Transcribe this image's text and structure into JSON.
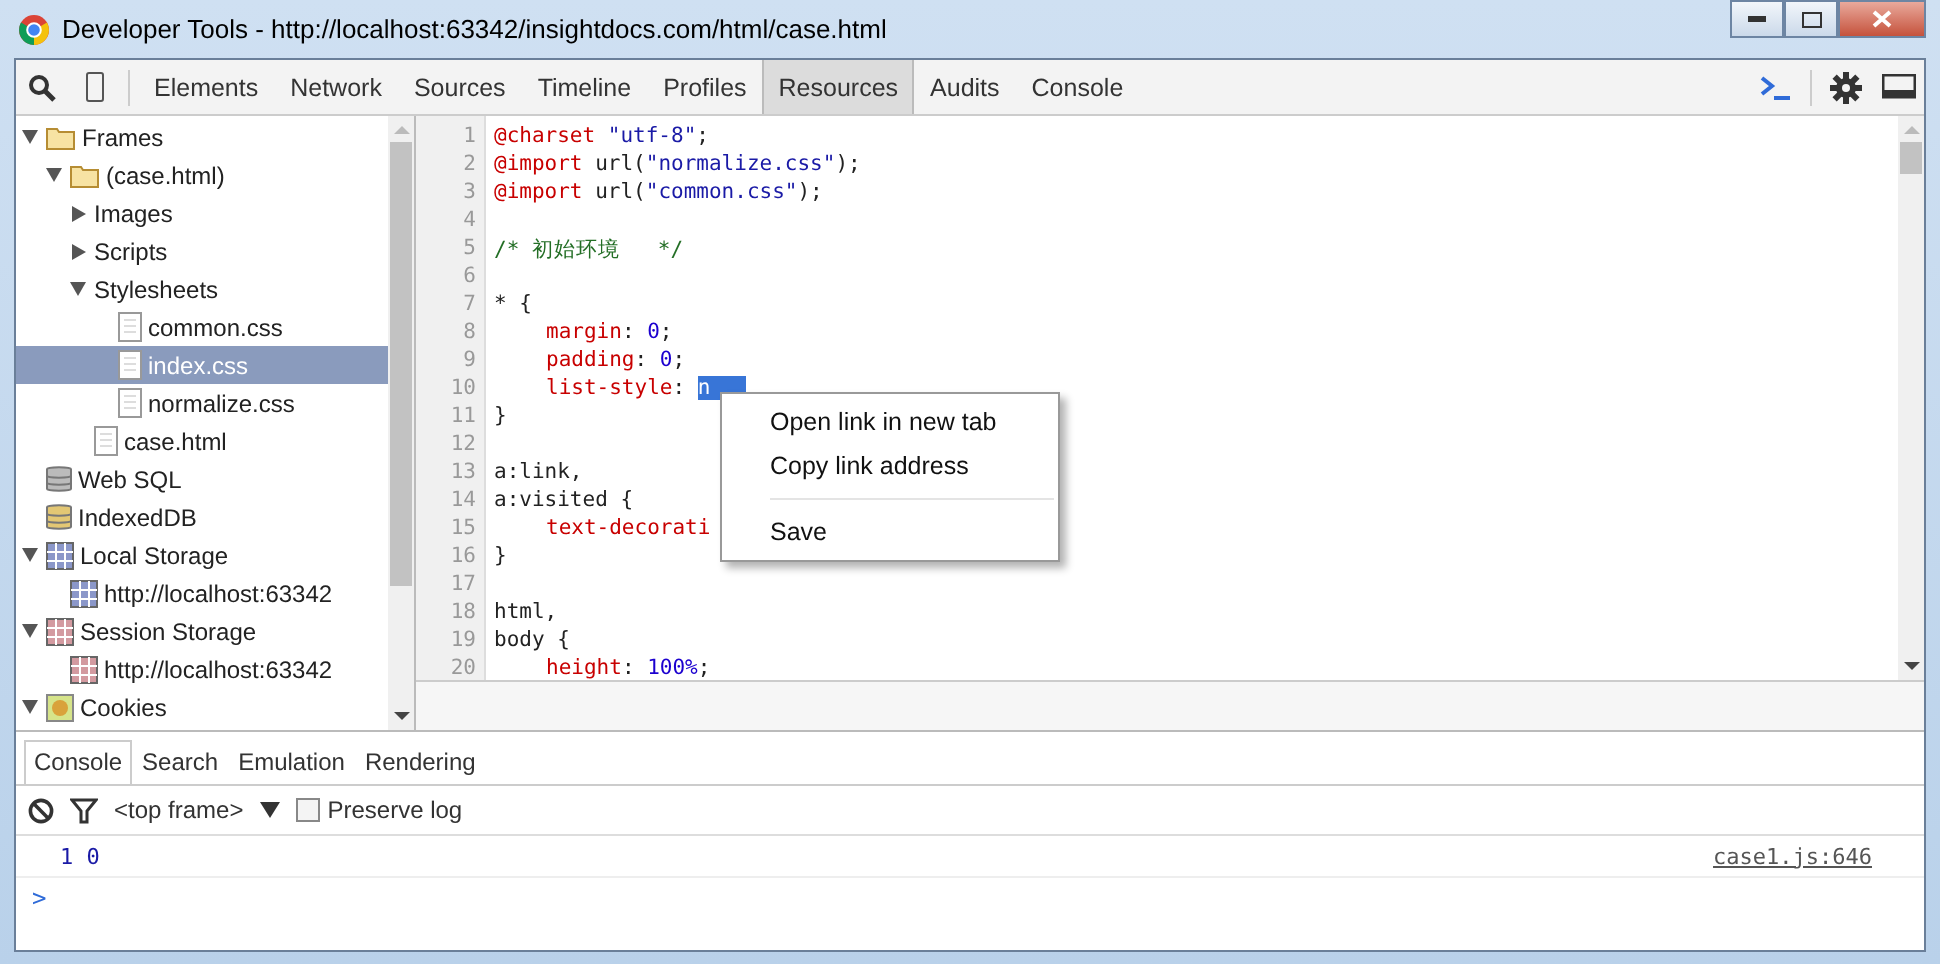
{
  "window": {
    "title": "Developer Tools - http://localhost:63342/insightdocs.com/html/case.html"
  },
  "toolbar": {
    "tabs": [
      {
        "label": "Elements",
        "selected": false
      },
      {
        "label": "Network",
        "selected": false
      },
      {
        "label": "Sources",
        "selected": false
      },
      {
        "label": "Timeline",
        "selected": false
      },
      {
        "label": "Profiles",
        "selected": false
      },
      {
        "label": "Resources",
        "selected": true
      },
      {
        "label": "Audits",
        "selected": false
      },
      {
        "label": "Console",
        "selected": false
      }
    ]
  },
  "sidebar": {
    "items": [
      {
        "label": "Frames",
        "kind": "folder",
        "expanded": true,
        "selected": false,
        "children": [
          {
            "label": "(case.html)",
            "kind": "folder",
            "expanded": true,
            "selected": false,
            "children": [
              {
                "label": "Images",
                "kind": "group",
                "expanded": false,
                "selected": false
              },
              {
                "label": "Scripts",
                "kind": "group",
                "expanded": false,
                "selected": false
              },
              {
                "label": "Stylesheets",
                "kind": "group",
                "expanded": true,
                "selected": false,
                "children": [
                  {
                    "label": "common.css",
                    "kind": "file",
                    "selected": false
                  },
                  {
                    "label": "index.css",
                    "kind": "file",
                    "selected": true
                  },
                  {
                    "label": "normalize.css",
                    "kind": "file",
                    "selected": false
                  }
                ]
              },
              {
                "label": "case.html",
                "kind": "file",
                "selected": false
              }
            ]
          }
        ]
      },
      {
        "label": "Web SQL",
        "kind": "database",
        "selected": false
      },
      {
        "label": "IndexedDB",
        "kind": "indexeddb",
        "selected": false
      },
      {
        "label": "Local Storage",
        "kind": "local",
        "expanded": true,
        "selected": false,
        "children": [
          {
            "label": "http://localhost:63342",
            "kind": "local",
            "selected": false
          }
        ]
      },
      {
        "label": "Session Storage",
        "kind": "session",
        "expanded": true,
        "selected": false,
        "children": [
          {
            "label": "http://localhost:63342",
            "kind": "session",
            "selected": false
          }
        ]
      },
      {
        "label": "Cookies",
        "kind": "cookie",
        "expanded": true,
        "selected": false
      }
    ]
  },
  "editor": {
    "lines": [
      {
        "number": "1",
        "tokens": [
          {
            "kind": "at",
            "text": "@charset"
          },
          {
            "kind": "string",
            "text": " \"utf-8\""
          },
          {
            "kind": "plain",
            "text": ";"
          }
        ]
      },
      {
        "number": "2",
        "tokens": [
          {
            "kind": "at",
            "text": "@import"
          },
          {
            "kind": "plain",
            "text": " url("
          },
          {
            "kind": "string",
            "text": "\"normalize.css\""
          },
          {
            "kind": "plain",
            "text": ");"
          }
        ]
      },
      {
        "number": "3",
        "tokens": [
          {
            "kind": "at",
            "text": "@import"
          },
          {
            "kind": "plain",
            "text": " url("
          },
          {
            "kind": "string",
            "text": "\"common.css\""
          },
          {
            "kind": "plain",
            "text": ");"
          }
        ]
      },
      {
        "number": "4"
      },
      {
        "number": "5",
        "tokens": [
          {
            "kind": "comment",
            "text": "/* 初始环境   */"
          }
        ]
      },
      {
        "number": "6"
      },
      {
        "number": "7",
        "tokens": [
          {
            "kind": "plain",
            "text": "* {"
          }
        ]
      },
      {
        "number": "8",
        "indented": true,
        "tokens": [
          {
            "kind": "property",
            "text": "margin"
          },
          {
            "kind": "plain",
            "text": ": "
          },
          {
            "kind": "number",
            "text": "0"
          },
          {
            "kind": "plain",
            "text": ";"
          }
        ]
      },
      {
        "number": "9",
        "indented": true,
        "tokens": [
          {
            "kind": "property",
            "text": "padding"
          },
          {
            "kind": "plain",
            "text": ": "
          },
          {
            "kind": "number",
            "text": "0"
          },
          {
            "kind": "plain",
            "text": ";"
          }
        ]
      },
      {
        "number": "10",
        "indented": true,
        "tokens": [
          {
            "kind": "property",
            "text": "list-style"
          },
          {
            "kind": "plain",
            "text": ": "
          },
          {
            "kind": "selection",
            "text": "n"
          }
        ]
      },
      {
        "number": "11",
        "tokens": [
          {
            "kind": "plain",
            "text": "}"
          }
        ]
      },
      {
        "number": "12"
      },
      {
        "number": "13",
        "tokens": [
          {
            "kind": "plain",
            "text": "a:link,"
          }
        ]
      },
      {
        "number": "14",
        "tokens": [
          {
            "kind": "plain",
            "text": "a:visited {"
          }
        ]
      },
      {
        "number": "15",
        "indented": true,
        "tokens": [
          {
            "kind": "property",
            "text": "text-decorati"
          }
        ]
      },
      {
        "number": "16",
        "tokens": [
          {
            "kind": "plain",
            "text": "}"
          }
        ]
      },
      {
        "number": "17"
      },
      {
        "number": "18",
        "tokens": [
          {
            "kind": "plain",
            "text": "html,"
          }
        ]
      },
      {
        "number": "19",
        "tokens": [
          {
            "kind": "plain",
            "text": "body {"
          }
        ]
      },
      {
        "number": "20",
        "indented": true,
        "tokens": [
          {
            "kind": "property",
            "text": "height"
          },
          {
            "kind": "plain",
            "text": ": "
          },
          {
            "kind": "number",
            "text": "100%"
          },
          {
            "kind": "plain",
            "text": ";"
          }
        ]
      }
    ]
  },
  "context_menu": {
    "items": [
      {
        "label": "Open link in new tab",
        "separator_after": false
      },
      {
        "label": "Copy link address",
        "separator_after": true
      },
      {
        "label": "Save",
        "separator_after": false
      }
    ]
  },
  "drawer": {
    "tabs": [
      {
        "label": "Console",
        "selected": true
      },
      {
        "label": "Search",
        "selected": false
      },
      {
        "label": "Emulation",
        "selected": false
      },
      {
        "label": "Rendering",
        "selected": false
      }
    ],
    "frame_select": "<top frame>",
    "preserve_log": {
      "label": "Preserve log",
      "checked": false
    },
    "messages": [
      {
        "text": "1 0",
        "source": "case1.js:646"
      }
    ],
    "prompt": ">"
  }
}
